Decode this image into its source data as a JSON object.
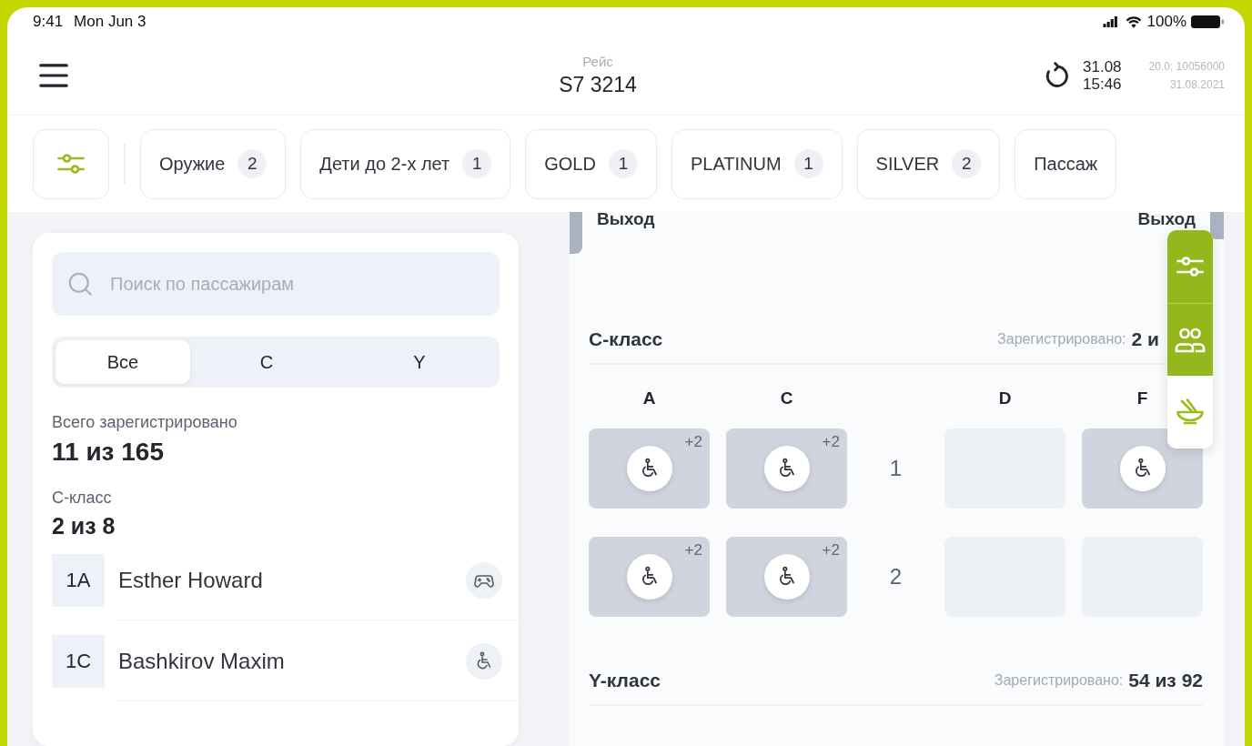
{
  "status_bar": {
    "time": "9:41",
    "date": "Mon Jun 3",
    "battery": "100%"
  },
  "header": {
    "flight_label": "Рейс",
    "flight": "S7 3214",
    "sync_date": "31.08",
    "sync_time": "15:46",
    "version": "20.0; 10056000",
    "version_date": "31.08.2021"
  },
  "filters": [
    {
      "label": "Оружие",
      "count": "2"
    },
    {
      "label": "Дети до 2-х лет",
      "count": "1"
    },
    {
      "label": "GOLD",
      "count": "1"
    },
    {
      "label": "PLATINUM",
      "count": "1"
    },
    {
      "label": "SILVER",
      "count": "2"
    },
    {
      "label": "Пассаж"
    }
  ],
  "search": {
    "placeholder": "Поиск по пассажирам"
  },
  "class_tabs": [
    {
      "label": "Все",
      "selected": true
    },
    {
      "label": "C",
      "selected": false
    },
    {
      "label": "Y",
      "selected": false
    }
  ],
  "totals": [
    {
      "label": "Всего зарегистрировано",
      "value": "11 из 165"
    },
    {
      "label": "С-класс",
      "value": "2 из 8"
    }
  ],
  "passengers": [
    {
      "seat": "1A",
      "name": "Esther Howard",
      "kind": "gamepad"
    },
    {
      "seat": "1C",
      "name": "Bashkirov Maxim",
      "kind": "wheelchair"
    }
  ],
  "seat_map": {
    "exits": [
      "Выход",
      "Выход"
    ],
    "sections": [
      {
        "title": "С-класс",
        "registered_label": "Зарегистрировано:",
        "registered": "2 и",
        "columns": [
          "A",
          "C",
          "D",
          "F"
        ],
        "rows": [
          {
            "number": "1",
            "seats": [
              {
                "kind": "occupied",
                "extra": "+2"
              },
              {
                "kind": "occupied",
                "extra": "+2"
              },
              {
                "kind": "empty"
              },
              {
                "kind": "occupied"
              }
            ]
          },
          {
            "number": "2",
            "seats": [
              {
                "kind": "occupied",
                "extra": "+2"
              },
              {
                "kind": "occupied",
                "extra": "+2"
              },
              {
                "kind": "empty"
              },
              {
                "kind": "empty"
              }
            ]
          }
        ]
      },
      {
        "title": "Y-класс",
        "registered_label": "Зарегистрировано:",
        "registered": "54 из 92"
      }
    ]
  },
  "side_toolbar": [
    {
      "kind": "filters",
      "active": true
    },
    {
      "kind": "people",
      "active": true
    },
    {
      "kind": "meal",
      "active": false
    }
  ]
}
